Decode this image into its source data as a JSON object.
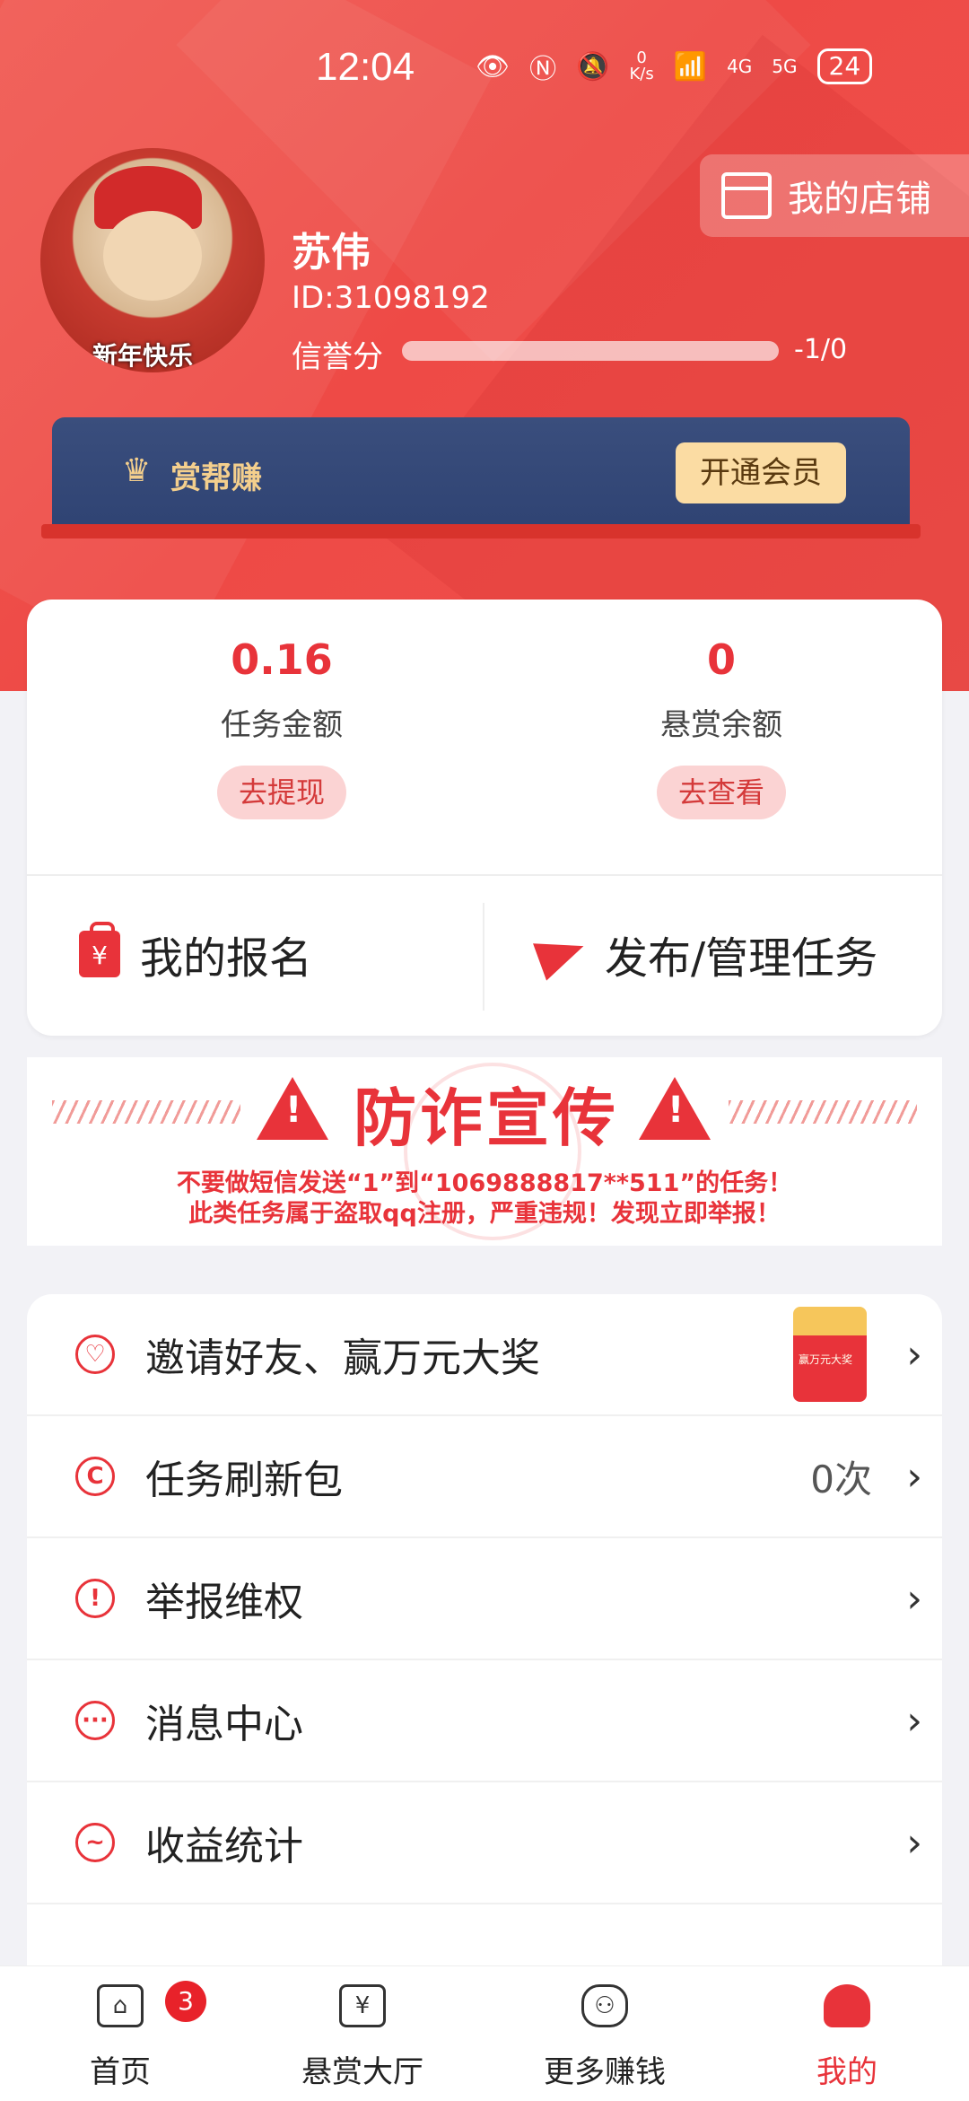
{
  "status_bar": {
    "time": "12:04",
    "net_speed_top": "0",
    "net_speed_bottom": "K/s",
    "signal_1": "4G",
    "signal_2": "5G",
    "battery": "24"
  },
  "profile": {
    "avatar_caption": "新年快乐",
    "name": "苏伟",
    "id": "ID:31098192",
    "credit_label": "信誉分",
    "credit_value": "-1/0",
    "shop_button": "我的店铺"
  },
  "vip": {
    "title": "赏帮赚",
    "open_button": "开通会员"
  },
  "stats": {
    "task_amount": "0.16",
    "task_amount_label": "任务金额",
    "withdraw_button": "去提现",
    "reward_balance": "0",
    "reward_balance_label": "悬赏余额",
    "view_button": "去查看"
  },
  "actions": {
    "my_signups": "我的报名",
    "publish_manage": "发布/管理任务"
  },
  "fraud": {
    "title": "防诈宣传",
    "line1": "不要做短信发送“1”到“1069888817**511”的任务！",
    "line2": "此类任务属于盗取qq注册，严重违规！发现立即举报！"
  },
  "menu": [
    {
      "label": "邀请好友、赢万元大奖",
      "extra": ""
    },
    {
      "label": "任务刷新包",
      "extra": "0次"
    },
    {
      "label": "举报维权",
      "extra": ""
    },
    {
      "label": "消息中心",
      "extra": ""
    },
    {
      "label": "收益统计",
      "extra": ""
    }
  ],
  "redpacket_text": "赢万元大奖",
  "nav": [
    {
      "label": "首页",
      "badge": "3"
    },
    {
      "label": "悬赏大厅"
    },
    {
      "label": "更多赚钱"
    },
    {
      "label": "我的"
    }
  ],
  "colors": {
    "primary_red": "#e8333a",
    "vip_navy": "#2f4373",
    "vip_gold": "#f4cf8d"
  }
}
